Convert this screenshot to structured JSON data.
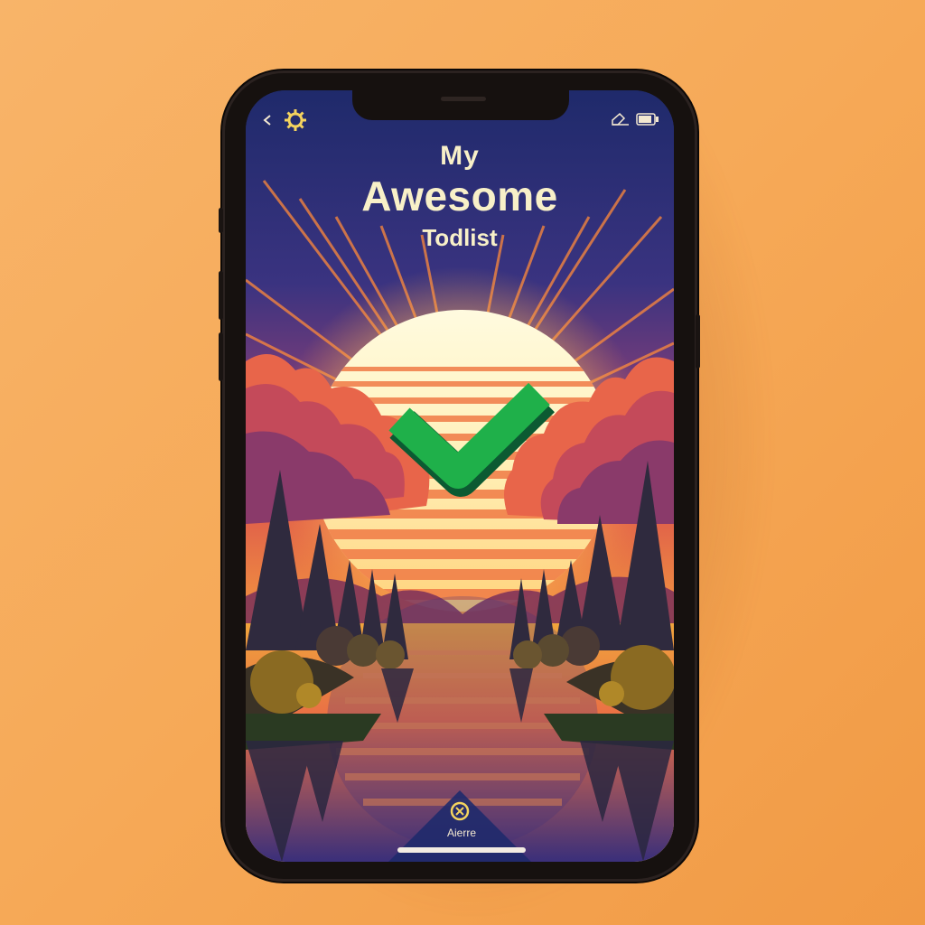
{
  "app": {
    "title_line1": "My",
    "title_line2": "Awesome",
    "title_line3": "Todlist"
  },
  "status_bar": {
    "back_icon": "chevron-left-icon",
    "settings_icon": "gear-icon",
    "edit_icon": "edit-icon",
    "battery_icon": "battery-icon"
  },
  "hero": {
    "icon": "checkmark-icon",
    "check_color": "#1fb04a"
  },
  "bottom_nav": {
    "icon": "close-circle-icon",
    "label": "Aierre"
  },
  "colors": {
    "background": "#f6a957",
    "sky_top": "#232d6e",
    "sun": "#fff3c4",
    "title": "#f8f0c8"
  }
}
